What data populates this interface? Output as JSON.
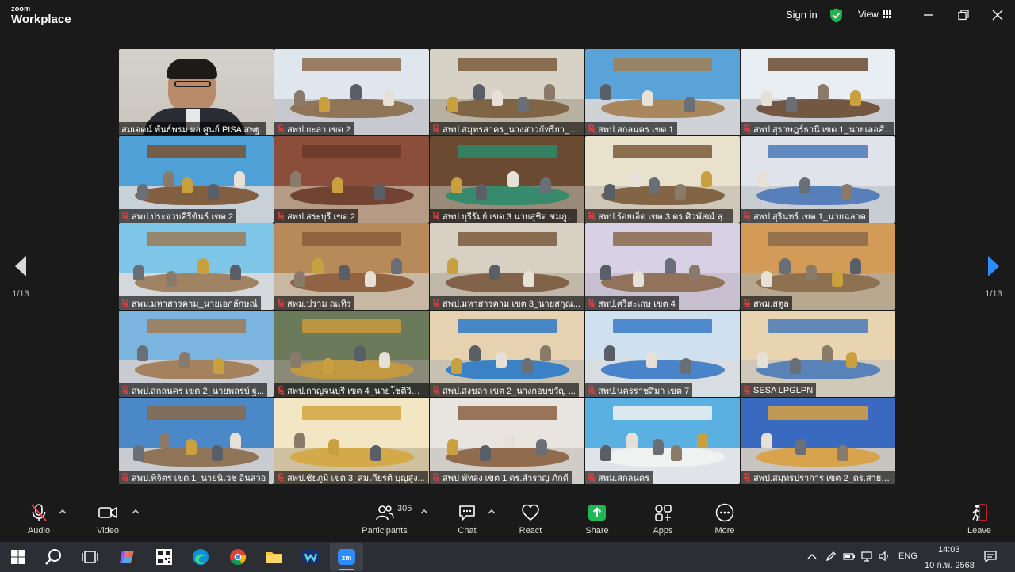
{
  "app": {
    "logo_line1": "zoom",
    "logo_line2": "Workplace"
  },
  "topbar": {
    "sign_in": "Sign in",
    "view": "View"
  },
  "pager": {
    "left": "1/13",
    "right": "1/13"
  },
  "tiles": [
    {
      "name": "สมเจตน์ พันธ์พรม ผอ.ศูนย์ PISA สพฐ.",
      "muted": false,
      "active": true,
      "scene": "speaker"
    },
    {
      "name": "สพป.ยะลา เขต 2",
      "muted": true,
      "scene": "room1"
    },
    {
      "name": "สพป.สมุทรสาคร_นางสาวกัทรียา_ค...",
      "muted": true,
      "scene": "room2"
    },
    {
      "name": "สพป.สกลนคร เขต 1",
      "muted": true,
      "scene": "room3"
    },
    {
      "name": "สพป.สุราษฎร์ธานี เขต 1_นายเลอศั...",
      "muted": true,
      "scene": "room4"
    },
    {
      "name": "สพป.ประจวบคีรีขันธ์ เขต 2",
      "muted": true,
      "scene": "room5"
    },
    {
      "name": "สพป.สระบุรี เขต 2",
      "muted": true,
      "scene": "room6"
    },
    {
      "name": "สพป.บุรีรัมย์ เขต 3 นายสุชิต ชมภู...",
      "muted": true,
      "scene": "room7"
    },
    {
      "name": "สพป.ร้อยเอ็ด เขต 3 ดร.ศิวพัสณ์ สุ...",
      "muted": true,
      "scene": "room8"
    },
    {
      "name": "สพป.สุรินทร์ เขต 1_นายฉลาด",
      "muted": true,
      "scene": "room9"
    },
    {
      "name": "สพม.มหาสารคาม_นายเอกลักษณ์",
      "muted": true,
      "scene": "room10"
    },
    {
      "name": "สพม.ปราม ณเทิร",
      "muted": true,
      "scene": "room11"
    },
    {
      "name": "สพป.มหาสารคาม เขต 3_นายสกุณ...",
      "muted": true,
      "scene": "room12"
    },
    {
      "name": "สพป.ศรีสะเกษ เขต 4",
      "muted": true,
      "scene": "room13"
    },
    {
      "name": "สพม.สตูล",
      "muted": true,
      "scene": "room14"
    },
    {
      "name": "สพป.สกลนคร เขต 2_นายพลรบ์ ฐ...",
      "muted": true,
      "scene": "room15"
    },
    {
      "name": "สพป.กาญจนบุรี เขต 4_นายโชติวิณ...",
      "muted": true,
      "scene": "room16"
    },
    {
      "name": "สพป.สงขลา เขต 2_นางกอบขวัญ ...",
      "muted": true,
      "scene": "room17"
    },
    {
      "name": "สพป.นครราชสีมา เขต 7",
      "muted": true,
      "scene": "room18"
    },
    {
      "name": "SESA LPGLPN",
      "muted": true,
      "scene": "room19"
    },
    {
      "name": "สพป.พิจิตร เขต 1_นายนิเวช อินสวอ",
      "muted": true,
      "scene": "room20"
    },
    {
      "name": "สพป.ชัยภูมิ เขต 3_สมเกียรติ บุญสูง...",
      "muted": true,
      "scene": "room21"
    },
    {
      "name": "สพป พัทลุง เขต 1 ดร.สำราญ ภักดี",
      "muted": true,
      "scene": "room22"
    },
    {
      "name": "สพม.สกลนคร",
      "muted": true,
      "scene": "room23"
    },
    {
      "name": "สพป.สมุทรปราการ เขต 2_ดร.สายฝน",
      "muted": true,
      "scene": "room24"
    }
  ],
  "toolbar": {
    "audio": "Audio",
    "video": "Video",
    "participants": "Participants",
    "participant_count": "305",
    "chat": "Chat",
    "react": "React",
    "share": "Share",
    "apps": "Apps",
    "more": "More",
    "leave": "Leave"
  },
  "taskbar": {
    "lang": "ENG",
    "time": "14:03",
    "date": "10 ก.พ. 2568"
  },
  "colors": {
    "accent_green": "#3fcf6c",
    "leave_red": "#e02828",
    "muted_red": "#e04040"
  }
}
